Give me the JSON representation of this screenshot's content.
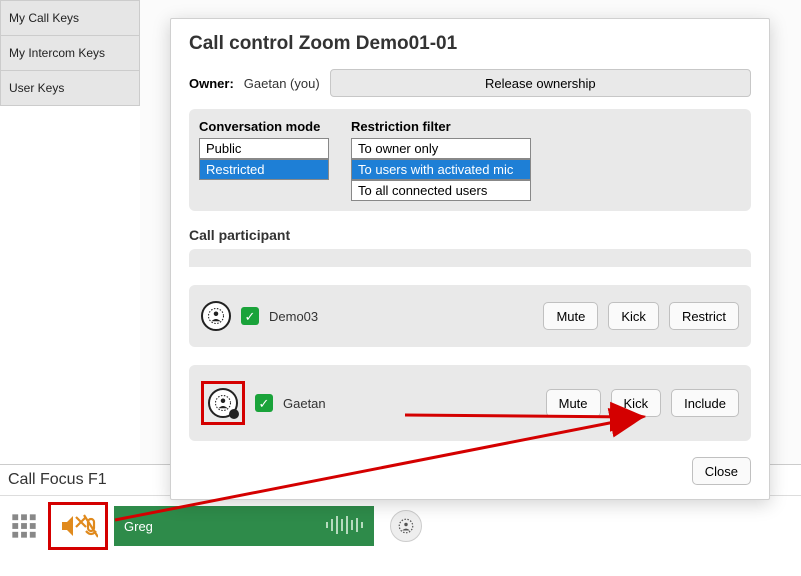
{
  "sidebar": {
    "tabs": [
      {
        "label": "My Call Keys"
      },
      {
        "label": "My Intercom Keys"
      },
      {
        "label": "User Keys"
      }
    ]
  },
  "callFocus": {
    "title": "Call Focus F1",
    "activeCall": {
      "name": "Greg",
      "mutedIcon": "speaker-mic-muted"
    }
  },
  "modal": {
    "title": "Call control Zoom Demo01-01",
    "ownerLabel": "Owner:",
    "ownerValue": "Gaetan (you)",
    "releaseBtn": "Release ownership",
    "conversationMode": {
      "heading": "Conversation mode",
      "options": [
        "Public",
        "Restricted"
      ],
      "selectedIndex": 1
    },
    "restrictionFilter": {
      "heading": "Restriction filter",
      "options": [
        "To owner only",
        "To users with activated mic",
        "To all connected users"
      ],
      "selectedIndex": 1
    },
    "participantsHeading": "Call participant",
    "participants": [
      {
        "name": "Demo03",
        "checked": true,
        "actions": [
          "Mute",
          "Kick",
          "Restrict"
        ]
      },
      {
        "name": "Gaetan",
        "checked": true,
        "actions": [
          "Mute",
          "Kick",
          "Include"
        ],
        "highlighted": true
      }
    ],
    "closeBtn": "Close",
    "buttons": {
      "mute": "Mute",
      "kick": "Kick",
      "restrict": "Restrict",
      "include": "Include"
    }
  }
}
